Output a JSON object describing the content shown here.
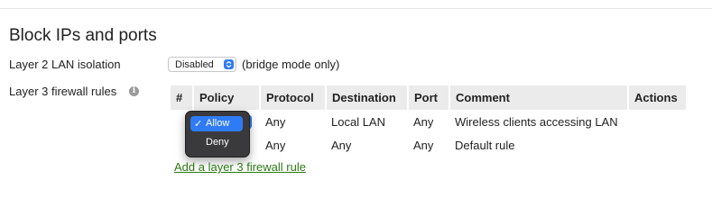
{
  "page": {
    "title": "Block IPs and ports"
  },
  "layer2": {
    "label": "Layer 2 LAN isolation",
    "selected": "Disabled",
    "note": "(bridge mode only)"
  },
  "layer3": {
    "label": "Layer 3 firewall rules",
    "headers": [
      "#",
      "Policy",
      "Protocol",
      "Destination",
      "Port",
      "Comment",
      "Actions"
    ],
    "rows": [
      {
        "protocol": "Any",
        "destination": "Local LAN",
        "port": "Any",
        "comment": "Wireless clients accessing LAN"
      },
      {
        "protocol": "Any",
        "destination": "Any",
        "port": "Any",
        "comment": "Default rule"
      }
    ],
    "add_link": "Add a layer 3 firewall rule"
  },
  "policy_dropdown": {
    "options": [
      "Allow",
      "Deny"
    ],
    "selected": "Allow",
    "check": "✓"
  },
  "colors": {
    "accent": "#2f7bf6",
    "link": "#2a7a12",
    "header_bg": "#ebebeb"
  }
}
